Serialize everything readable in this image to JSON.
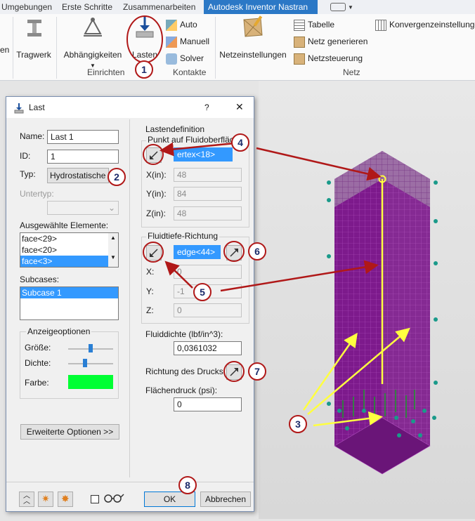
{
  "tabs": [
    "Umgebungen",
    "Erste Schritte",
    "Zusammenarbeiten",
    "Autodesk Inventor Nastran"
  ],
  "ribbon": {
    "partial_left": "en",
    "tragwerk": "Tragwerk",
    "abhaengigkeiten": "Abhängigkeiten",
    "lasten": "Lasten",
    "auto": "Auto",
    "manuell": "Manuell",
    "solver": "Solver",
    "netzeinstellungen": "Netzeinstellungen",
    "tabelle": "Tabelle",
    "netz_generieren": "Netz generieren",
    "netzsteuerung": "Netzsteuerung",
    "konvergenz": "Konvergenzeinstellunge",
    "group_einrichten": "Einrichten",
    "group_kontakte": "Kontakte",
    "group_netz": "Netz"
  },
  "dialog": {
    "title": "Last",
    "help": "?",
    "close": "✕",
    "name_label": "Name:",
    "name_value": "Last 1",
    "id_label": "ID:",
    "id_value": "1",
    "typ_label": "Typ:",
    "typ_value": "Hydrostatische l",
    "untertyp_label": "Untertyp:",
    "selected_label": "Ausgewählte Elemente:",
    "selected_items": [
      "face<29>",
      "face<20>",
      "face<3>"
    ],
    "subcases_label": "Subcases:",
    "subcases_items": [
      "Subcase 1"
    ],
    "display_group": "Anzeigeoptionen",
    "groesse": "Größe:",
    "dichte": "Dichte:",
    "farbe": "Farbe:",
    "farbe_color": "#00ff33",
    "groesse_level": 0.5,
    "dichte_level": 0.37,
    "advanced_button": "Erweiterte Optionen >>",
    "lastdef_group": "Lastendefinition",
    "punkt_label": "Punkt auf Fluidoberfläche",
    "punkt_value": "ertex<18>",
    "pxin": "X(in):",
    "pxv": "48",
    "pyin": "Y(in):",
    "pyv": "84",
    "pzin": "Z(in):",
    "pzv": "48",
    "fluidtiefe_group": "Fluidtiefe-Richtung",
    "edge_value": "edge<44>",
    "dx": "X:",
    "dxv": "0",
    "dy": "Y:",
    "dyv": "-1",
    "dz": "Z:",
    "dzv": "0",
    "fluiddichte_label": "Fluiddichte (lbf/in^3):",
    "fluiddichte_value": "0,0361032",
    "richtung_label": "Richtung des Drucks:",
    "flaechendruck_label": "Flächendruck (psi):",
    "flaechendruck_value": "0",
    "ok": "OK",
    "cancel": "Abbrechen"
  },
  "badges": [
    "1",
    "2",
    "3",
    "4",
    "5",
    "6",
    "7",
    "8"
  ],
  "colors": {
    "accent": "#2b78c6",
    "selection": "#3399ff",
    "annotation_red": "#b01818",
    "annotation_yellow": "#ffff40",
    "model_purple": "#7d1a8c"
  }
}
